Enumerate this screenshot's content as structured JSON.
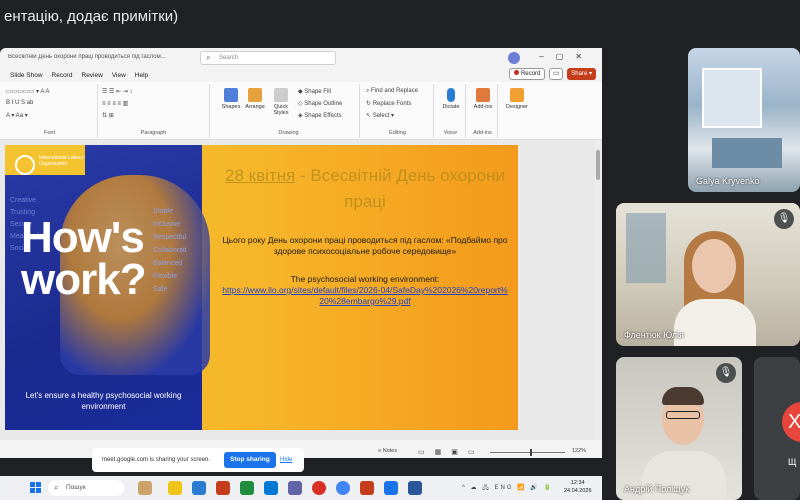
{
  "meet": {
    "title": "ентацію, додає примітки)"
  },
  "ppt": {
    "doc_title": "Всесвітній День охорони праці проводиться під гаслом...",
    "search_placeholder": "Search",
    "menu": [
      "Slide Show",
      "Record",
      "Review",
      "View",
      "Help"
    ],
    "record_label": "Record",
    "share_label": "Share",
    "ribbon": {
      "groups": [
        "Font",
        "Paragraph",
        "Drawing",
        "Editing",
        "Voice",
        "Add-ins"
      ],
      "shapes_label": "Shapes",
      "arrange_label": "Arrange",
      "quick_styles_label": "Quick Styles",
      "shape_fill": "Shape Fill",
      "shape_outline": "Shape Outline",
      "shape_effects": "Shape Effects",
      "find_replace": "Find and Replace",
      "replace_fonts": "Replace Fonts",
      "select": "Select",
      "dictate": "Dictate",
      "addins": "Add-ins",
      "designer": "Designer"
    },
    "slide": {
      "heading_underlined": "28 квітня",
      "heading_rest": " - Всесвітній День охорони праці",
      "body_text": "Цього року День охорони праці проводиться під гаслом: «Подбаймо про здорове психосоціальне робоче середовище»",
      "english_title": "The psychosocial working environment:",
      "link": "https://www.ilo.org/sites/default/files/2026-04/SafeDay%202026%20report%20%28embargo%29.pdf",
      "poster": {
        "org": "International Labour Organization",
        "headline_1": "How's",
        "headline_2": "work?",
        "side_words": [
          "Stable",
          "Inclusive",
          "Respectful",
          "Collaborati",
          "Balanced",
          "Flexible",
          "Safe"
        ],
        "left_words": [
          "Creative",
          "Trusting",
          "Secure",
          "Meaningful",
          "Social"
        ],
        "tagline": "Let's ensure a healthy psychosocial working environment"
      }
    },
    "status": {
      "notes_label": "Notes",
      "zoom": "122%"
    }
  },
  "sharebar": {
    "message": "meet.google.com is sharing your screen.",
    "stop_label": "Stop sharing",
    "hide_label": "Hide"
  },
  "taskbar": {
    "search_placeholder": "Пошук",
    "tray": "ENG",
    "time": "12:34",
    "date": "24.04.2026"
  },
  "participants": [
    {
      "name": "Galya Kryvenko"
    },
    {
      "name": "Флентюк Юлія"
    },
    {
      "name": "Андрій Поліщук"
    },
    {
      "name": "Щ",
      "initial": "Х"
    }
  ]
}
